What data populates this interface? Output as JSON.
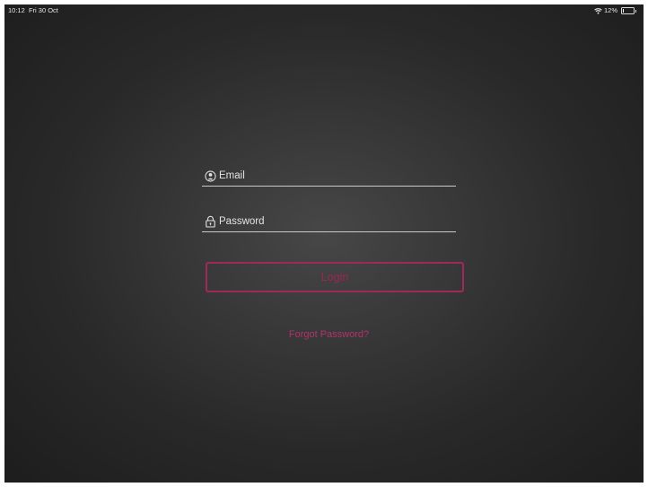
{
  "status_bar": {
    "time": "10:12",
    "date": "Fri 30 Oct",
    "battery_percent_label": "12%",
    "battery_level": 0.12,
    "wifi_icon": "wifi-icon",
    "battery_icon": "battery-icon"
  },
  "login_form": {
    "email": {
      "placeholder": "Email",
      "value": "",
      "icon": "user-icon"
    },
    "password": {
      "placeholder": "Password",
      "value": "",
      "icon": "lock-icon"
    },
    "login_button_label": "Login",
    "forgot_password_label": "Forgot Password?"
  },
  "colors": {
    "accent": "#a3285a",
    "link": "#b3336a",
    "background": "#333333",
    "text": "#eaeaea"
  }
}
